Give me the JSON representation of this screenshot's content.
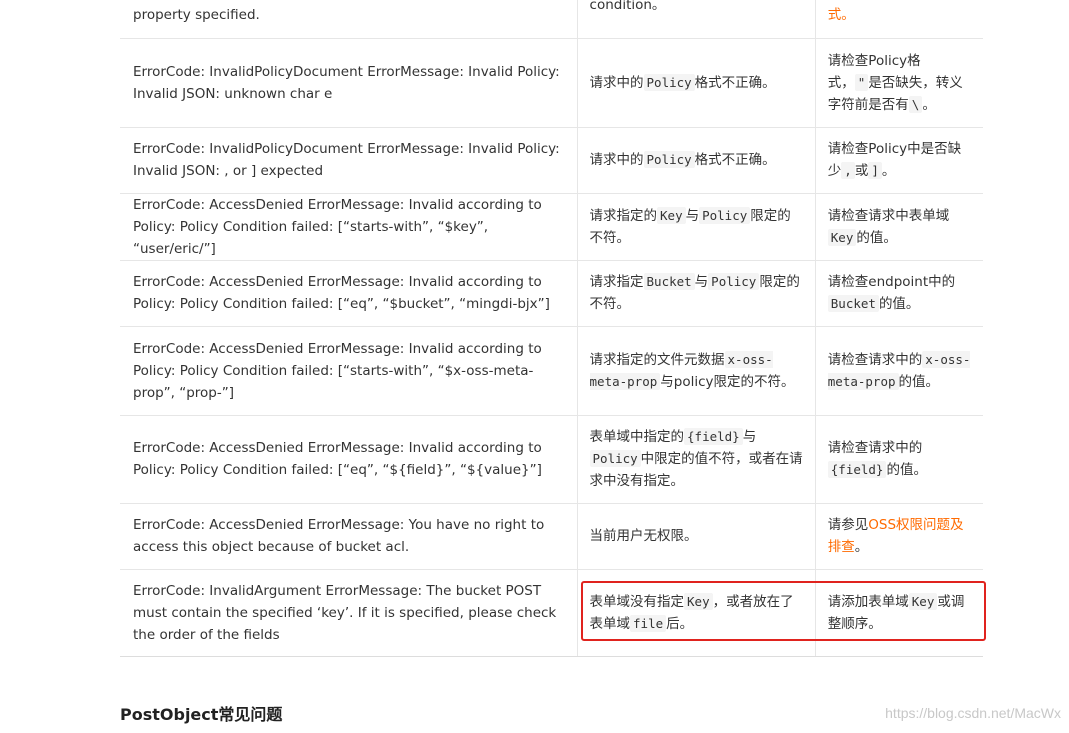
{
  "rows": [
    {
      "error": "property specified.",
      "cause": "condition。",
      "fix": "式。",
      "fix_is_link": true
    },
    {
      "error": "ErrorCode: InvalidPolicyDocument ErrorMessage: Invalid Policy: Invalid JSON: unknown char e",
      "cause_parts": [
        "请求中的",
        "Policy",
        "格式不正确。"
      ],
      "fix_parts": [
        "请检查Policy格式，",
        "\"",
        "是否缺失，转义字符前是否有",
        "\\",
        "。"
      ]
    },
    {
      "error": "ErrorCode: InvalidPolicyDocument ErrorMessage: Invalid Policy: Invalid JSON: , or ] expected",
      "cause_parts": [
        "请求中的",
        "Policy",
        "格式不正确。"
      ],
      "fix_parts": [
        "请检查Policy中是否缺少",
        ",",
        "或",
        "]",
        "。"
      ]
    },
    {
      "error": "ErrorCode: AccessDenied ErrorMessage: Invalid according to Policy: Policy Condition failed: [“starts-with”, “$key”, “user/eric/”]",
      "cause_parts": [
        "请求指定的",
        "Key",
        "与",
        "Policy",
        "限定的不符。"
      ],
      "fix_parts": [
        "请检查请求中表单域",
        "Key",
        "的值。"
      ]
    },
    {
      "error": "ErrorCode: AccessDenied ErrorMessage: Invalid according to Policy: Policy Condition failed: [“eq”, “$bucket”, “mingdi-bjx”]",
      "cause_parts": [
        "请求指定",
        "Bucket",
        "与",
        "Policy",
        "限定的不符。"
      ],
      "fix_parts": [
        "请检查endpoint中的",
        "Bucket",
        "的值。"
      ]
    },
    {
      "error": "ErrorCode: AccessDenied ErrorMessage: Invalid according to Policy: Policy Condition failed: [“starts-with”, “$x-oss-meta-prop”, “prop-”]",
      "cause_parts": [
        "请求指定的文件元数据",
        "x-oss-meta-prop",
        "与policy限定的不符。"
      ],
      "fix_parts": [
        "请检查请求中的",
        "x-oss-meta-prop",
        "的值。"
      ]
    },
    {
      "error": "ErrorCode: AccessDenied ErrorMessage: Invalid according to Policy: Policy Condition failed: [“eq”, “${field}”, “${value}”]",
      "cause_parts": [
        "表单域中指定的",
        "{field}",
        "与",
        "Policy",
        "中限定的值不符，或者在请求中没有指定。"
      ],
      "fix_parts": [
        "请检查请求中的",
        "{field}",
        "的值。"
      ]
    },
    {
      "error": "ErrorCode: AccessDenied ErrorMessage: You have no right to access this object because of bucket acl.",
      "cause": "当前用户无权限。",
      "fix_prefix": "请参见",
      "fix_link": "OSS权限问题及排查",
      "fix_suffix": "。"
    },
    {
      "error": "ErrorCode: InvalidArgument ErrorMessage: The bucket POST must contain the specified ‘key’. If it is specified, please check the order of the fields",
      "cause_parts": [
        "表单域没有指定",
        "Key",
        "，或者放在了表单域",
        "file",
        "后。"
      ],
      "fix_parts": [
        "请添加表单域",
        "Key",
        "或调整顺序。"
      ]
    }
  ],
  "section_title": "PostObject常见问题",
  "watermark": "https://blog.csdn.net/MacWx",
  "colors": {
    "link": "#ff6a00",
    "highlight": "#e0231e",
    "border": "#e6e6e6"
  }
}
